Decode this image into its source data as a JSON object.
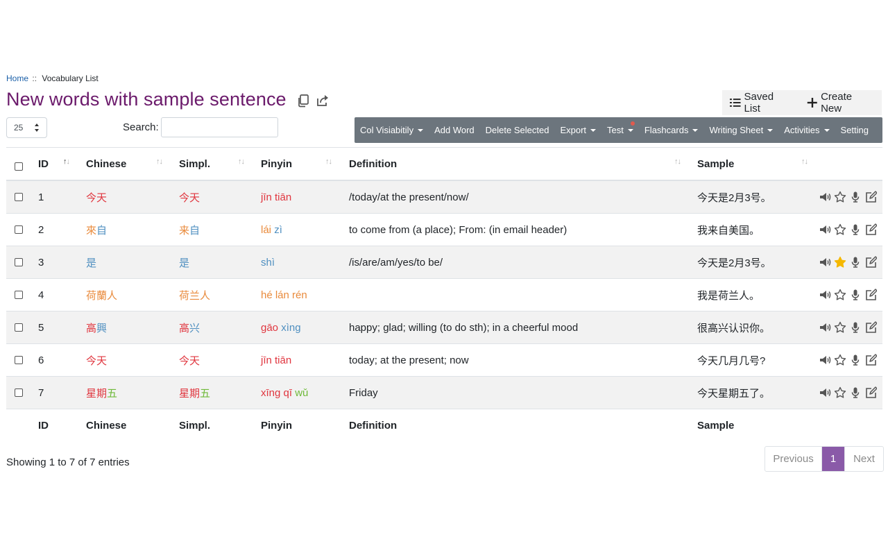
{
  "breadcrumb": {
    "home": "Home",
    "sep": "::",
    "current": "Vocabulary List"
  },
  "page": {
    "title": "New words with sample sentence"
  },
  "saved_bar": {
    "saved_list": "Saved List",
    "create_new": "Create New"
  },
  "controls": {
    "page_length": "25",
    "search_label": "Search:",
    "search_value": ""
  },
  "toolbar": {
    "col_visibility": "Col Visiabitily",
    "add_word": "Add Word",
    "delete_selected": "Delete Selected",
    "export": "Export",
    "test": "Test",
    "flashcards": "Flashcards",
    "writing_sheet": "Writing Sheet",
    "activities": "Activities",
    "setting": "Setting"
  },
  "table": {
    "columns": {
      "id": "ID",
      "chinese": "Chinese",
      "simpl": "Simpl.",
      "pinyin": "Pinyin",
      "definition": "Definition",
      "sample": "Sample"
    },
    "rows": [
      {
        "id": "1",
        "chinese": [
          [
            "今天",
            "t1"
          ]
        ],
        "simpl": [
          [
            "今天",
            "t1"
          ]
        ],
        "pinyin": [
          [
            "jīn tiān",
            "t1"
          ]
        ],
        "definition": "/today/at the present/now/",
        "sample": "今天是2月3号。",
        "starred": false
      },
      {
        "id": "2",
        "chinese": [
          [
            "來",
            "t2"
          ],
          [
            "自",
            "t3"
          ]
        ],
        "simpl": [
          [
            "来",
            "t2"
          ],
          [
            "自",
            "t3"
          ]
        ],
        "pinyin": [
          [
            "lái ",
            "t2"
          ],
          [
            "zì",
            "t3"
          ]
        ],
        "definition": "to come from (a place); From: (in email header)",
        "sample": "我来自美国。",
        "starred": false
      },
      {
        "id": "3",
        "chinese": [
          [
            "是",
            "t3"
          ]
        ],
        "simpl": [
          [
            "是",
            "t3"
          ]
        ],
        "pinyin": [
          [
            "shì",
            "t3"
          ]
        ],
        "definition": "/is/are/am/yes/to be/",
        "sample": "今天是2月3号。",
        "starred": true
      },
      {
        "id": "4",
        "chinese": [
          [
            "荷蘭人",
            "t2"
          ]
        ],
        "simpl": [
          [
            "荷兰人",
            "t2"
          ]
        ],
        "pinyin": [
          [
            "hé lán rén",
            "t2"
          ]
        ],
        "definition": "",
        "sample": "我是荷兰人。",
        "starred": false
      },
      {
        "id": "5",
        "chinese": [
          [
            "高",
            "t1"
          ],
          [
            "興",
            "t3"
          ]
        ],
        "simpl": [
          [
            "高",
            "t1"
          ],
          [
            "兴",
            "t3"
          ]
        ],
        "pinyin": [
          [
            "gāo ",
            "t1"
          ],
          [
            "xìng",
            "t3"
          ]
        ],
        "definition": "happy; glad; willing (to do sth); in a cheerful mood",
        "sample": "很高兴认识你。",
        "starred": false
      },
      {
        "id": "6",
        "chinese": [
          [
            "今天",
            "t1"
          ]
        ],
        "simpl": [
          [
            "今天",
            "t1"
          ]
        ],
        "pinyin": [
          [
            "jīn tiān",
            "t1"
          ]
        ],
        "definition": "today; at the present; now",
        "sample": "今天几月几号?",
        "starred": false
      },
      {
        "id": "7",
        "chinese": [
          [
            "星期",
            "t1"
          ],
          [
            "五",
            "t5"
          ]
        ],
        "simpl": [
          [
            "星期",
            "t1"
          ],
          [
            "五",
            "t5"
          ]
        ],
        "pinyin": [
          [
            "xīng qī ",
            "t1"
          ],
          [
            "wǔ",
            "t5"
          ]
        ],
        "definition": "Friday",
        "sample": "今天星期五了。",
        "starred": false
      }
    ]
  },
  "footer": {
    "info": "Showing 1 to 7 of 7 entries",
    "previous": "Previous",
    "page": "1",
    "next": "Next"
  },
  "icons": {
    "copy": "copy-icon",
    "share": "share-icon",
    "list": "list-icon",
    "plus": "plus-icon",
    "speaker": "speaker-icon",
    "star": "star-icon",
    "mic": "microphone-icon",
    "edit": "edit-icon"
  },
  "colors": {
    "title": "#6b1a6b",
    "toolbar": "#6c757d",
    "pager_active": "#8a5aa8",
    "star": "#f5b800",
    "tone1": "#e0353e",
    "tone2": "#e98a3b",
    "tone4": "#4f8fc0",
    "tone3": "#6fb93a"
  }
}
